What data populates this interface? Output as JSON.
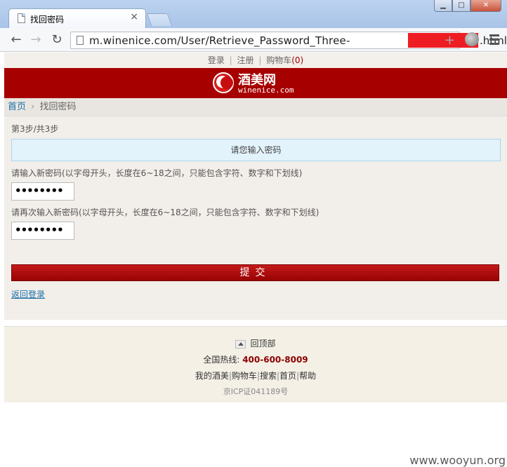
{
  "browser": {
    "tab_title": "找回密码",
    "tab_close": "×",
    "url": "m.winenice.com/User/Retrieve_Password_Three-",
    "url_end": ".html",
    "back_glyph": "←",
    "forward_glyph": "→",
    "reload_glyph": "↻",
    "star_glyph": "+",
    "window_buttons": {
      "minimize": "▁",
      "maximize": "□",
      "close": "✕"
    }
  },
  "topbar": {
    "login": "登录",
    "register": "注册",
    "cart": "购物车",
    "cart_count": "(0)",
    "sep": "|"
  },
  "header": {
    "logo_cn": "酒美网",
    "logo_en": "winenice.com"
  },
  "breadcrumb": {
    "home": "首页",
    "arrow": "›",
    "current": "找回密码"
  },
  "form": {
    "step": "第3步/共3步",
    "notice": "请您输入密码",
    "new_password_label": "请输入新密码(以字母开头，长度在6~18之间，只能包含字符、数字和下划线)",
    "new_password_value": "••••••••",
    "confirm_password_label": "请再次输入新密码(以字母开头，长度在6~18之间，只能包含字符、数字和下划线)",
    "confirm_password_value": "••••••••",
    "submit": "提交",
    "back_to_login": "返回登录"
  },
  "footer": {
    "back_to_top": "回顶部",
    "hotline_label": "全国热线:",
    "hotline_number": "400-600-8009",
    "links": [
      "我的酒美",
      "购物车",
      "搜索",
      "首页",
      "帮助"
    ],
    "icp": "京ICP证041189号"
  },
  "watermark": "www.wooyun.org",
  "colors": {
    "brand_red": "#a70000",
    "link_blue": "#1a6fa8",
    "notice_bg": "#e3f3fc"
  }
}
